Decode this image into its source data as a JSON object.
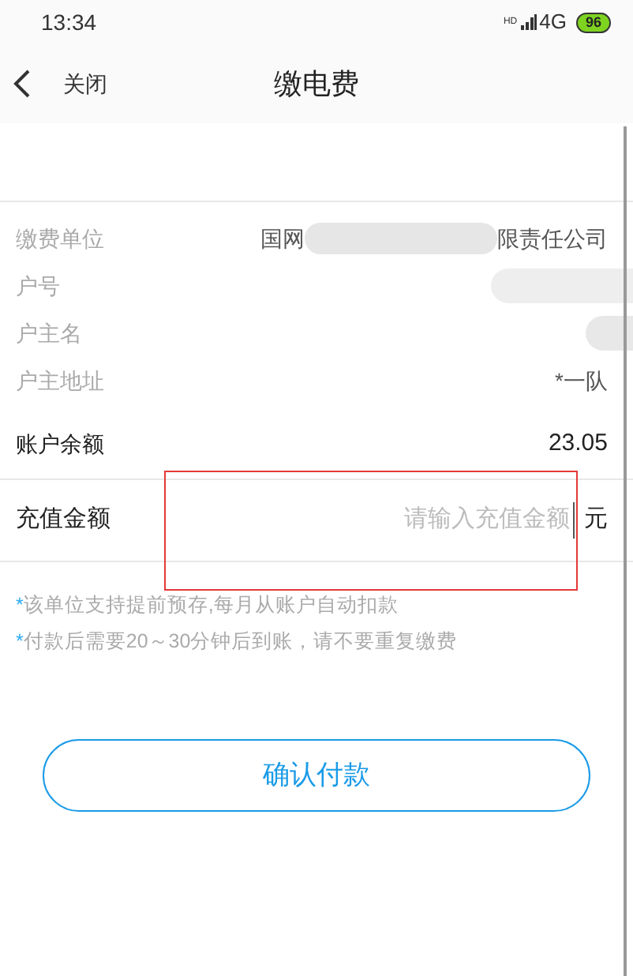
{
  "status_bar": {
    "time": "13:34",
    "hd": "HD",
    "network": "4G",
    "battery": "96"
  },
  "header": {
    "back_label": "关闭",
    "title": "缴电费"
  },
  "info_rows": [
    {
      "kind": "partial",
      "label": "缴费单位",
      "prefix": "国网",
      "suffix": "限责任公司"
    },
    {
      "kind": "masked",
      "label": "户号"
    },
    {
      "kind": "masked",
      "label": "户主名"
    },
    {
      "kind": "text",
      "label": "户主地址",
      "value": "*一队"
    }
  ],
  "balance": {
    "label": "账户余额",
    "value": "23.05"
  },
  "recharge": {
    "label": "充值金额",
    "placeholder": "请输入充值金额",
    "unit": "元",
    "highlighted": true
  },
  "notes": [
    {
      "mark": "*",
      "text": "该单位支持提前预存,每月从账户自动扣款"
    },
    {
      "mark": "*",
      "text": "付款后需要20～30分钟后到账，请不要重复缴费"
    }
  ],
  "confirm_button": "确认付款"
}
